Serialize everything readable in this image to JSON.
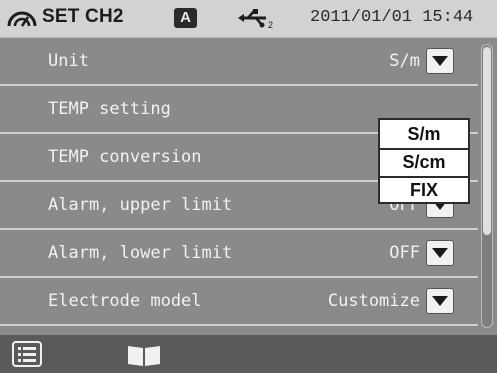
{
  "header": {
    "title": "SET CH2",
    "mode_badge": "A",
    "datetime": "2011/01/01 15:44",
    "icons": [
      "channel-icon",
      "usb-icon"
    ]
  },
  "rows": [
    {
      "label": "Unit",
      "value": "S/m"
    },
    {
      "label": "TEMP setting",
      "value": ""
    },
    {
      "label": "TEMP conversion",
      "value": ""
    },
    {
      "label": "Alarm, upper limit",
      "value": "OFF"
    },
    {
      "label": "Alarm, lower limit",
      "value": "OFF"
    },
    {
      "label": "Electrode model",
      "value": "Customize"
    }
  ],
  "unit_popup": {
    "options": [
      "S/m",
      "S/cm",
      "FIX"
    ]
  },
  "footer": {
    "icons": [
      "list-icon",
      "book-icon"
    ]
  },
  "colors": {
    "background": "#8a8a8a",
    "header": "#d2d2d2",
    "footer": "#5a5a5a",
    "row_text": "#f2f2f2"
  }
}
